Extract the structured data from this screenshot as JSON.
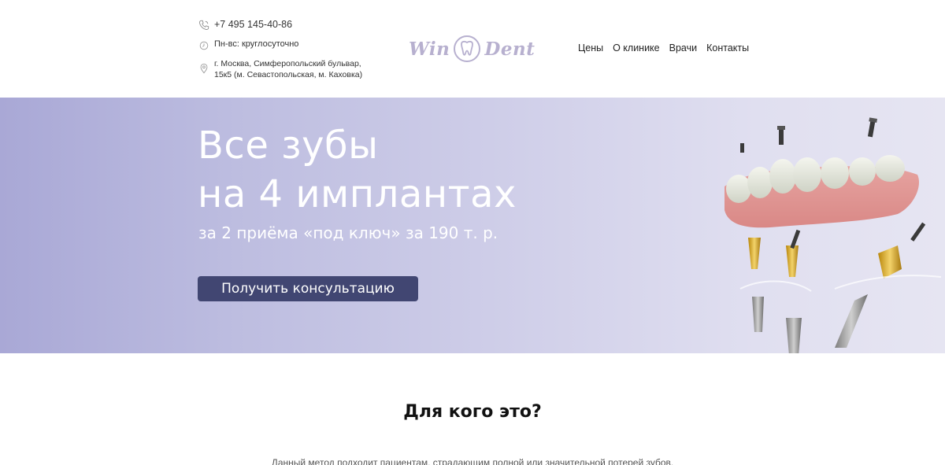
{
  "header": {
    "phone": "+7 495 145-40-86",
    "hours": "Пн-вс: круглосуточно",
    "address_line1": "г. Москва, Симферопольский бульвар,",
    "address_line2": "15к5 (м. Севастопольская, м. Каховка)",
    "logo_left": "Win",
    "logo_right": "Dent",
    "nav": [
      "Цены",
      "О клинике",
      "Врачи",
      "Контакты"
    ],
    "icons": [
      "phone-icon",
      "clock-icon",
      "location-pin-icon",
      "tooth-icon"
    ]
  },
  "hero": {
    "title_line1": "Все зубы",
    "title_line2": "на 4 имплантах",
    "subtitle": "за 2 приёма «под ключ» за 190 т. р.",
    "cta_label": "Получить консультацию"
  },
  "section": {
    "title": "Для кого это?",
    "text": "Данный метод подходит пациентам, страдающим полной или значительной потерей зубов."
  },
  "colors": {
    "accent": "#414672",
    "logo": "#b7b0cf",
    "hero_gradient_start": "#a9a8d6",
    "hero_gradient_end": "#e6e5f2"
  }
}
